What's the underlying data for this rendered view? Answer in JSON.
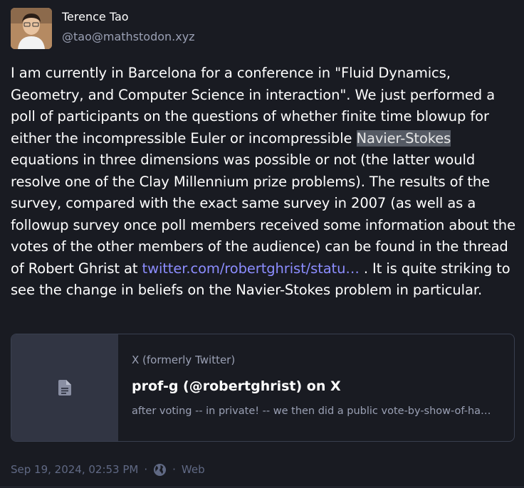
{
  "author": {
    "display_name": "Terence Tao",
    "handle": "@tao@mathstodon.xyz"
  },
  "content": {
    "text_before": "I am currently in Barcelona for a conference in \"Fluid Dynamics, Geometry, and Computer Science in interaction\".  We just performed a poll of participants on the questions of whether finite time blowup for either the incompressible Euler or incompressible ",
    "highlight": "Navier-Stokes",
    "text_middle": " equations in three dimensions was possible or not (the latter would resolve one of the Clay Millennium prize problems).  The results of the survey, compared with the exact same survey in 2007 (as well as a followup survey once poll members received some information about the votes of the other members of the audience) can be found in the thread of Robert Ghrist at ",
    "link_text": "twitter.com/robertghrist/statu…",
    "text_after": " .  It is quite striking to see the change in beliefs on the Navier-Stokes problem in particular."
  },
  "card": {
    "provider": "X (formerly Twitter)",
    "title": "prof-g (@robertghrist) on X",
    "description": "after voting -- in private! -- we then did a public vote-by-show-of-ha…",
    "thumb_icon": "document-icon"
  },
  "meta": {
    "timestamp": "Sep 19, 2024, 02:53 PM",
    "separator": "·",
    "visibility_icon": "globe-icon",
    "application": "Web"
  },
  "colors": {
    "background": "#191b22",
    "link": "#8c8dff",
    "muted": "#9aa0b4",
    "highlight_bg": "#555a64"
  }
}
